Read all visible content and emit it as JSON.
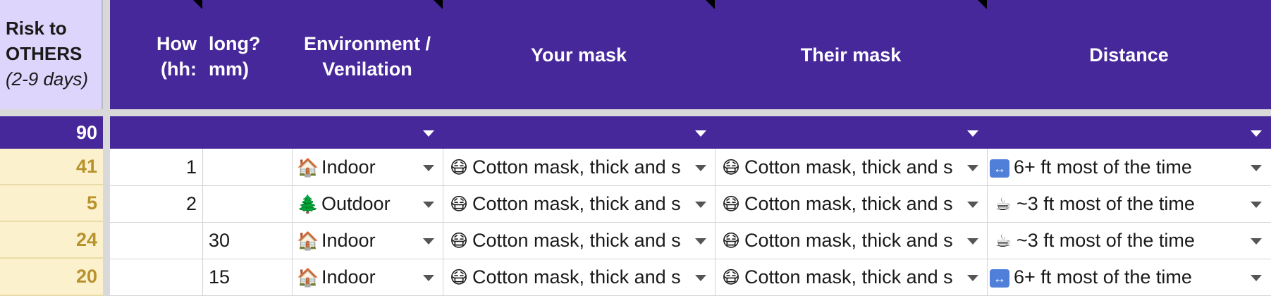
{
  "risk_column": {
    "title_line1": "Risk to",
    "title_line2": "OTHERS",
    "subtitle": "(2-9 days)",
    "total": "90"
  },
  "headers": {
    "how_long_hh": "How (hh:",
    "how_long_mm": "long? mm)",
    "environment": "Environment / Venilation",
    "your_mask": "Your mask",
    "their_mask": "Their mask",
    "distance": "Distance"
  },
  "rows": [
    {
      "risk": "41",
      "hh": "1",
      "mm": "",
      "env_icon": "house-icon",
      "env_glyph": "🏠",
      "environment": "Indoor",
      "your_mask": "Cotton mask, thick and s",
      "their_mask": "Cotton mask, thick and s",
      "dist_icon": "left-right-arrow-icon",
      "dist_glyph": "↔",
      "distance": "6+ ft most of the time"
    },
    {
      "risk": "5",
      "hh": "2",
      "mm": "",
      "env_icon": "tree-icon",
      "env_glyph": "🌲",
      "environment": "Outdoor",
      "your_mask": "Cotton mask, thick and s",
      "their_mask": "Cotton mask, thick and s",
      "dist_icon": "coffee-icon",
      "dist_glyph": "☕",
      "distance": "~3 ft most of the time"
    },
    {
      "risk": "24",
      "hh": "",
      "mm": "30",
      "env_icon": "house-icon",
      "env_glyph": "🏠",
      "environment": "Indoor",
      "your_mask": "Cotton mask, thick and s",
      "their_mask": "Cotton mask, thick and s",
      "dist_icon": "coffee-icon",
      "dist_glyph": "☕",
      "distance": "~3 ft most of the time"
    },
    {
      "risk": "20",
      "hh": "",
      "mm": "15",
      "env_icon": "house-icon",
      "env_glyph": "🏠",
      "environment": "Indoor",
      "your_mask": "Cotton mask, thick and s",
      "their_mask": "Cotton mask, thick and s",
      "dist_icon": "left-right-arrow-icon",
      "dist_glyph": "↔",
      "distance": "6+ ft most of the time"
    }
  ],
  "mask_icon": "masked-face-icon",
  "mask_glyph": "😷",
  "colors": {
    "header_bg": "#46289b",
    "risk_header_bg": "#ddd5fb",
    "risk_cell_bg": "#fcf1cd",
    "risk_cell_text": "#b8922c"
  }
}
